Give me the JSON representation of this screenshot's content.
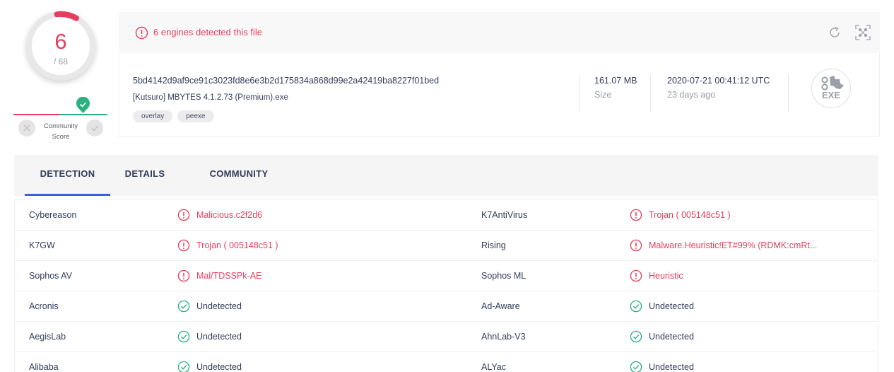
{
  "score": {
    "detections": "6",
    "total": "/ 68",
    "community_label_line1": "Community",
    "community_label_line2": "Score"
  },
  "alert": {
    "text": "6 engines detected this file"
  },
  "file": {
    "hash": "5bd4142d9af9ce91c3023fd8e6e3b2d175834a868d99e2a42419ba8227f01bed",
    "name": "[Kutsuro] MBYTES 4.1.2.73 (Premium).exe",
    "tags": [
      "overlay",
      "peexe"
    ],
    "size_value": "161.07 MB",
    "size_label": "Size",
    "date_value": "2020-07-21 00:41:12 UTC",
    "date_relative": "23 days ago",
    "type_badge": "EXE"
  },
  "tabs": [
    {
      "label": "DETECTION",
      "active": true
    },
    {
      "label": "DETAILS",
      "active": false
    },
    {
      "label": "COMMUNITY",
      "active": false
    }
  ],
  "detections": [
    {
      "left": {
        "engine": "Cybereason",
        "result": "Malicious.c2f2d6",
        "status": "malicious"
      },
      "right": {
        "engine": "K7AntiVirus",
        "result": "Trojan ( 005148c51 )",
        "status": "malicious"
      }
    },
    {
      "left": {
        "engine": "K7GW",
        "result": "Trojan ( 005148c51 )",
        "status": "malicious"
      },
      "right": {
        "engine": "Rising",
        "result": "Malware.Heuristic!ET#99% (RDMK:cmRt...",
        "status": "malicious"
      }
    },
    {
      "left": {
        "engine": "Sophos AV",
        "result": "Mal/TDSSPk-AE",
        "status": "malicious"
      },
      "right": {
        "engine": "Sophos ML",
        "result": "Heuristic",
        "status": "malicious"
      }
    },
    {
      "left": {
        "engine": "Acronis",
        "result": "Undetected",
        "status": "undetected"
      },
      "right": {
        "engine": "Ad-Aware",
        "result": "Undetected",
        "status": "undetected"
      }
    },
    {
      "left": {
        "engine": "AegisLab",
        "result": "Undetected",
        "status": "undetected"
      },
      "right": {
        "engine": "AhnLab-V3",
        "result": "Undetected",
        "status": "undetected"
      }
    },
    {
      "left": {
        "engine": "Alibaba",
        "result": "Undetected",
        "status": "undetected"
      },
      "right": {
        "engine": "ALYac",
        "result": "Undetected",
        "status": "undetected"
      }
    }
  ],
  "colors": {
    "malicious": "#e53e5e",
    "undetected": "#2cb07f",
    "accent": "#3b61d6"
  }
}
